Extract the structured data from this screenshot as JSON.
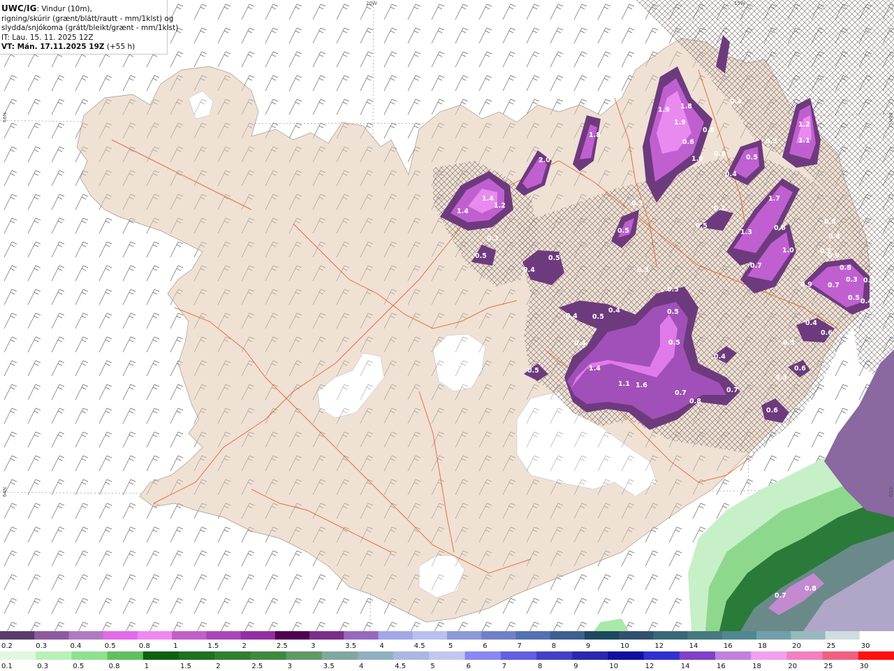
{
  "header": {
    "line1_bold": "UWC/IG",
    "line1_rest": ": Vindur (10m),",
    "line2": "rigning/skúrir (grænt/blátt/rautt - mm/1klst) og",
    "line3": "slydda/snjókoma (grátt/bleikt/grænt - mm/1klst)",
    "line4": "IT: Lau. 15. 11. 2025 12Z",
    "line5_bold": "VT: Mán. 17.11.2025 19Z",
    "line5_rest": " (+55 h)"
  },
  "meridians": {
    "top_20w": "20W",
    "top_15w": "15W",
    "left_66n": "66N",
    "left_64n": "64N",
    "right_66n": "66N",
    "right_65n": "65N"
  },
  "snow_scale": {
    "labels": [
      "0.2",
      "0.3",
      "0.4",
      "0.5",
      "0.8",
      "1",
      "1.5",
      "2",
      "2.5",
      "3",
      "3.5",
      "4",
      "4.5",
      "5",
      "6",
      "7",
      "8",
      "9",
      "10",
      "12",
      "14",
      "16",
      "18",
      "20",
      "25",
      "30"
    ],
    "colors": [
      "#5a3a6e",
      "#8e5a9e",
      "#b07ac0",
      "#e06ae8",
      "#ee88f0",
      "#c060c8",
      "#a848b8",
      "#9030a0",
      "#500050",
      "#783088",
      "#9868c0",
      "#a0a8e8",
      "#b8c0f0",
      "#8c98d8",
      "#7080c8",
      "#5470b0",
      "#3c6090",
      "#1c4860",
      "#305070",
      "#386878",
      "#487880",
      "#508890",
      "#70a0a8",
      "#98b8c0",
      "#d0dce0",
      "#ffffff"
    ]
  },
  "rain_scale": {
    "labels": [
      "0.1",
      "0.3",
      "0.5",
      "0.8",
      "1",
      "1.5",
      "2",
      "2.5",
      "3",
      "3.5",
      "4",
      "4.5",
      "5",
      "6",
      "7",
      "8",
      "9",
      "10",
      "12",
      "14",
      "16",
      "18",
      "20",
      "25",
      "30"
    ],
    "colors": [
      "#e0f8e0",
      "#b8f0b8",
      "#90e090",
      "#60c060",
      "#106010",
      "#207020",
      "#308030",
      "#408840",
      "#609868",
      "#80a8a0",
      "#90b0c0",
      "#a8b8e0",
      "#c0c8f0",
      "#8888f0",
      "#6060e0",
      "#4040c8",
      "#2828b0",
      "#1010a0",
      "#3030d0",
      "#8040c8",
      "#c080e0",
      "#f0a0f0",
      "#f080c0",
      "#f06080",
      "#ff1010"
    ]
  },
  "precip_labels": [
    "1.9",
    "1.8",
    "1.9",
    "0.8",
    "0.6",
    "1.8",
    "2.0",
    "1.4",
    "1.4",
    "1.2",
    "1.0",
    "0.8",
    "0.4",
    "0.4",
    "0.5",
    "1.2",
    "1.1",
    "1.7",
    "1.3",
    "0.5",
    "0.3",
    "0.5",
    "0.5",
    "0.3",
    "0.4",
    "0.5",
    "1.0",
    "0.9",
    "0.6",
    "0.5",
    "0.9",
    "0.8",
    "0.3",
    "0.7",
    "0.5",
    "0.3",
    "0.5",
    "0.4",
    "0.5",
    "0.5",
    "0.5",
    "0.4",
    "0.6",
    "0.4",
    "0.4",
    "0.4",
    "0.5",
    "0.3",
    "1.4",
    "1.1",
    "1.6",
    "0.7",
    "0.8",
    "0.7",
    "0.6",
    "0.4",
    "0.3",
    "0.6",
    "0.7",
    "0.8",
    "0.3",
    "0.5",
    "0.4",
    "0.3",
    "0.7",
    "0.2"
  ],
  "colors": {
    "land": "#efe1d4",
    "glacier": "#ffffff",
    "road": "#e8703a",
    "barb": "#555555",
    "snow_dark": "#6e3a7e",
    "snow_mid": "#a050b8",
    "snow_light": "#e07ae8",
    "rain_light": "#c8f0c8",
    "rain_mid": "#78c878",
    "rain_dark": "#1a5a2a",
    "sleet_grey": "#b4b0bc"
  }
}
